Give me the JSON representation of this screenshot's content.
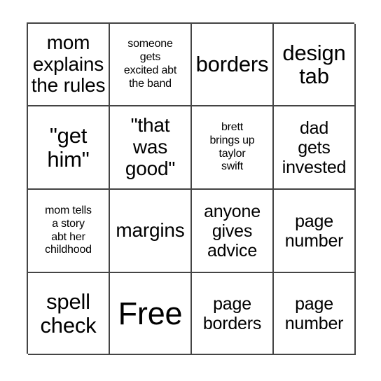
{
  "card": {
    "type": "bingo-card",
    "columns": 4,
    "rows": 4,
    "border_color": "#444444",
    "background_color": "#ffffff",
    "text_color": "#000000",
    "free_space": {
      "label": "Free",
      "row": 4,
      "column": 2
    },
    "cells": [
      {
        "id": "r1c1",
        "text": "mom\nexplains\nthe rules",
        "size": "lg"
      },
      {
        "id": "r1c2",
        "text": "someone\ngets\nexcited abt\nthe band",
        "size": "xs"
      },
      {
        "id": "r1c3",
        "text": "borders",
        "size": "xl"
      },
      {
        "id": "r1c4",
        "text": "design\ntab",
        "size": "xl"
      },
      {
        "id": "r2c1",
        "text": "\"get\nhim\"",
        "size": "xl"
      },
      {
        "id": "r2c2",
        "text": "\"that\nwas\ngood\"",
        "size": "lg"
      },
      {
        "id": "r2c3",
        "text": "brett\nbrings up\ntaylor\nswift",
        "size": "xs"
      },
      {
        "id": "r2c4",
        "text": "dad\ngets\ninvested",
        "size": "md"
      },
      {
        "id": "r3c1",
        "text": "mom tells\na story\nabt her\nchildhood",
        "size": "xs"
      },
      {
        "id": "r3c2",
        "text": "margins",
        "size": "lg"
      },
      {
        "id": "r3c3",
        "text": "anyone\ngives\nadvice",
        "size": "md"
      },
      {
        "id": "r3c4",
        "text": "page\nnumber",
        "size": "md"
      },
      {
        "id": "r4c1",
        "text": "spell\ncheck",
        "size": "xl"
      },
      {
        "id": "r4c2",
        "text": "Free",
        "size": "free"
      },
      {
        "id": "r4c3",
        "text": "page\nborders",
        "size": "md"
      },
      {
        "id": "r4c4",
        "text": "page\nnumber",
        "size": "md"
      }
    ]
  }
}
